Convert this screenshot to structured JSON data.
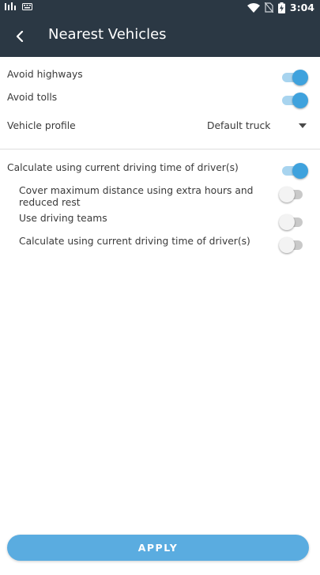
{
  "status_bar": {
    "time": "3:04",
    "icons": [
      "signal-icon",
      "keyboard-icon",
      "wifi-icon",
      "no-sim-icon",
      "battery-charging-icon"
    ]
  },
  "header": {
    "title": "Nearest Vehicles",
    "back_icon": "back-chevron-icon"
  },
  "settings": {
    "avoid_highways": {
      "label": "Avoid highways",
      "enabled": true
    },
    "avoid_tolls": {
      "label": "Avoid tolls",
      "enabled": true
    },
    "vehicle_profile": {
      "label": "Vehicle profile",
      "value": "Default truck"
    }
  },
  "driving_time": {
    "main": {
      "label": "Calculate using current driving time of driver(s)",
      "enabled": true
    },
    "options": [
      {
        "label": "Cover maximum distance using extra hours and reduced rest",
        "enabled": false
      },
      {
        "label": "Use driving teams",
        "enabled": false
      },
      {
        "label": "Calculate using current driving time of driver(s)",
        "enabled": false
      }
    ]
  },
  "footer": {
    "apply_label": "APPLY"
  },
  "colors": {
    "bar_bg": "#2b3844",
    "accent": "#3fa2dd",
    "accent_track": "#a8d4ef",
    "button": "#5aace0"
  }
}
